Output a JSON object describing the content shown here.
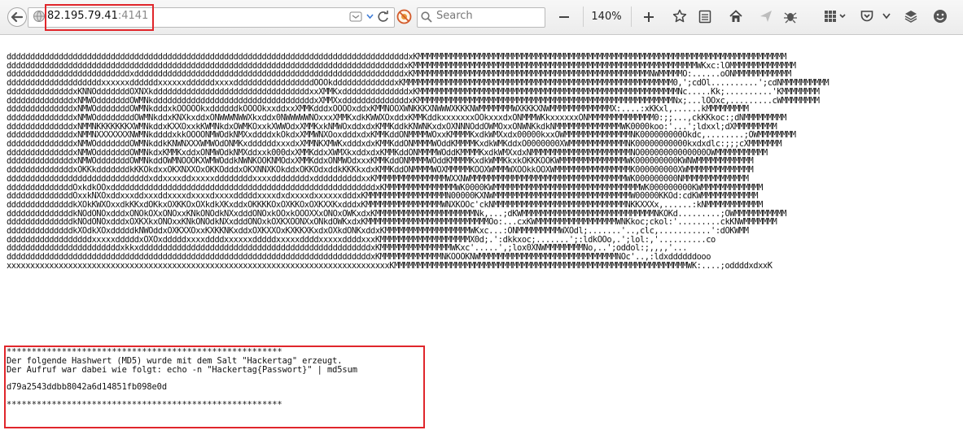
{
  "browser": {
    "url_host": "82.195.79.41",
    "url_port": ":4141",
    "search_placeholder": "Search",
    "zoom_level": "140%",
    "icons": [
      "back-icon",
      "site-info-icon",
      "reader-mode-icon",
      "dropdown-icon",
      "reload-icon",
      "addon-blocked-icon",
      "search-icon",
      "zoom-out-icon",
      "zoom-in-icon",
      "bookmark-star-icon",
      "reading-list-icon",
      "home-icon",
      "send-icon",
      "bug-icon",
      "grid-icon",
      "pocket-icon",
      "layers-icon",
      "smiley-icon"
    ],
    "highlight_color": "#e0262b"
  },
  "page": {
    "ascii_art": "dddddddddddddddddddddddddddddddddddddddddddddddddddddddddddddddddddddddddddddddddddddxKMMMMMMMMMMMMMMMMMMMMMMMMMMMMMMMMMMMMMMMMMMMMMMMMMMMMMMMMMMMMMMMMMMMMMMMMMMMMMM\nddddddddddddddddddddddddddddddddddddddddddddddddddddddddddddddddddddddddddddddddddddxKMMMMMMMMMMMMMMMMMMMMMMMMMMMMMMMMMMMMMMMMMMMMMMMMMMMMMMMMMMMMWKxc:lOMMMMMMMMMMMMMM\nddddddddddddddddddddddddddxdddddddddddddddddddddddddddddddddddddddddddddddddddddddddxKMMMMMMMMMMMMMMMMMMMMMMMMMMMMMMMMMMMMMMMMMMMMMMMMMMNWMMMMMO:......oONMMMMMMMMMMMM\nddddddddddddddddddddxxxxxxddddddxxxxxxddddddxxxxdddddddddddddddddOOOkdddddddddddddxKMMMMMMMMMMMMMMMMMMMMMMMMMMMMMMMMMMMMMMMMMMMMMMMMMMMMMMMMM0,';cdOl..........';cdNMMMMMMMMMM\nddddddddddddddxKNNOdddddddOXNXkdddddddddddddddddddddddddddddddddxxXMMKxddddddddddddddxKMMMMMMMMMMMMMMMMMMMMMMMMMMMMMMMMMMMMMMMMMMMMMMMMMMMMMMMNc.....Kk;..........'KMMMMMMMM\nddddddddddddddxNMWOdddddddOWMNkddddddddddddddddddddddddddddddddddxXMMXxddddddddddddddxKMMMMMMMMMMMMMMMMMMMMMMMMMMMMMMMMMMMMMMMMMMMMMMMMMMMMMMNx;...lOOxc,.........cWMMMMMMMM\nddddddddddddddxNMWOdddddddOWMNkdddxkOOOOOkxddddddkOOOOkxxddxxXMMKdddxOOOOxddxKMMNOOXWNKKKXNWWWXKKKNWMMMMMMMWXKKKXNWMMMMMMMMMMMMMX:....:xKKxl,......kMMMMMMMMM\nddddddddddddddxNMWOddddddddOWMNkddxKNXkxddxONWWWNWWXkxddx0NWWWWWNOxxxXMMKxdkKWWXOxddxKMMKddkxxxxxxxOOkxxxdxONMMMWKkxxxxxxONMMMMMMMMMMMMMM0:;;...,ckKKkoc:;dNMMMMMMMMM\nddddddddddddddxNMMNKKKKKKKXWMNkddxKXXOxxkKWMNkdxOWMKOxxkXWWOdxXMMKxkNMWOxddxdxKMMKddkKNWNKxdxOXNNNOddOWMOxxONWNKkdkNMMMMMMMMMMMMMMWK0000koo:'...';ldxxl;dXMMMMMMMMM\nddddddddddddddxNMMNXXXXXXXNWMNkddddxkkOOOONMWOdkNMXxddddxkOkdxXMMWNXOoxdddxdxKMMKddONMMMMWOxxKMMMMKxdkWMXxdx00000kxxOWMMMMMMMMMMMMMMNK000000000Okdc,........;OWMMMMMMMM\nddddddddddddddxNMWOdddddddOWMNkddkKNWNXXXWMWOdONMKxddddddxxxdxXMMNKXMWKxdddxdxKMMKddONMMMMWOddKMMMMKxdkWMKddxO0000000XWMMMMMMMMMMMMNK00000000000kxdxdlc:;;;cXMMMMMMM\nddddddddddddddxNMWOdddddddOWMNkdxKMMKxddxONMWOdkNMXddxxk000dxXMMKddxXWMXkxddxdxKMMKddONMMMMWOddKMMMMKxdkWMXxdxNMMMMMMMMMMMMMMMMMMMMMNO00000000000000OWMMMMMMMMMMM\nddddddddddddddxNMWOdddddddOWMNkddOWMNOOOKXWMWOddkNWNKOOKNMOdxXMMKddxONMWOdxxxKMMKddONMMMMWOddKMMMMKxdkWMMKkxkOKKKOOKWMMMMMMMMMMMMMMWK000000000KWNWMMMMMMMMMMMM\nddddddddddddddxOKKkdddddddkKKOkdxxOKXNXXOxOKKOdddxOKXNNXKOkddxOKKOdxddkKKKkxdxKMMKddONMMMMWOXMMMMMKOOXWMMMWXOOkkOOXWMMMMMMMMMMMMMMMMK000000000XWMMMMMMMMMMMMMM\nddddddddddddddddddddddddddddddxddxxxxddxxxxxddddddddxxxxddddddddxddddddddddxxKMMMMMMMMMMMMMMMWXXNWMMMMMMMMMMMMMMMMMMMMMMMMMMMMMMMMMWK000000000NMMMMMMMMMMMMMM\nddddddddddddddOxkdkOOxddddddddddddddddddddddddddddddddddddddddddddddddddddddddxKMMMMMMMMMMMMMMMWK0000KWMMMMMMMMMMMMMMMMMMMMMMMMMMMMMMMWK000000000KWMMMMMMMMMMMMM\nddddddddddddddOxxkNXOxddxxxddxxxddxxxxdxxxxdxxxxdddddxxxxdxdxxxxdxxxxxxdddxKMMMMMMMMMMMMMMMMMN00000KXNWMMMMMMMMMMMMMMMMMMMMMMMMMMMMMW00000KKOd:cdKWMMMMMMMMMMMM\nddddddddddddddkXOkKWXOxxdkKKxdOKkxOXKKOxOXkdkXKxddxOKKKKOxOXKKOxOXKXXKxdddxKMMMMMMMMMMMMMMMMWNXKOOc'ckNMMMMMMMMMMMMMMMMMMMMMMMMMMMMNKKXXXx,......:kNMMMMMMMMMMMM\nddddddddddddddkNOdONOxdddxONOkOXxONOxxKNkONOdkNXxdddONOxkOOxkOOOXXxONOxOWKxdxKMMMMMMMMMMMMMMMMMMMMMNk,...;dKWMMMMMMMMMMMMMMMMMMMMMMMMMMMMNKOKd.........;OWMMMMMMMMMMM\nddddddddddddddkNOdONOxdddxOXKXkxONOxxKNkONOdkNXxdddONOxkOXKXOONXxONkdOWKxdxKMMMMMMMMMMMMMMMMMMMMMMMMMMOo:...cxKWMMMMMMMMMMMMMMMMMWNKkoc;ckol:'.........ckKNWMMMMMMM\nddddddddddddddkXOdkXOxdddddkNWOddxOXKXXOxxKXKKNKxddxOXKXXOxKXKKXKxdxOXkdONKxddxKMMMMMMMMMMMMMMMMMMWKxc...:ONMMMMMMMMMWXOdl;.......'..,clc,...........':dOKWMM\nddddddddddddddddddxxxxxdddddxOXOxdddddxxxxddddxxxxxxdddddxxxxxddddxxxxxddddxxxKMMMMMMMMMMMMMMMMMMMX0d;.':dkkxoc;.......';:ldkOOo,.';lol:,'..........co\nddddddddddddddddddddddddxkkxdddddddddddddddddddddddddddddddddddddddddddddddddxKMMMMMMMMMMMMMMMWKxc'.....',;lox0XNWMMMMMMMMNo,..';oddol:;,,,,'...\ndddddddddddddddddddddddddddddddddddddddddddddddddddddddddddddddddddddddddddddxKMMMMMMMMMMMMMNKOOOKNWMMMMMMMMMMMMMMMMMMMMMMMMMMMMMNOc'..,:ldxddddddooo\nxxxxxxxxxxxxxxxxxxxxxxxxxxxxxxxxxxxxxxxxxxxxxxxxxxxxxxxxxxxxxxxxxxxxxxxxxxxxxxxxxKMMMMMMMMMMMMMMMMMMMMMMMMMMMMMMMMMMMMMMMMMMMMMMMMMMMMMMMMMMMMMMWK:....;oddddxdxxK",
    "message": "*******************************************************\nDer folgende Hashwert (MD5) wurde mit dem Salt \"Hackertag\" erzeugt.\nDer Aufruf war dabei wie folgt: echo -n \"Hackertag{Passwort}\" | md5sum\n\nd79a2543ddbb8042a6d14851fb098e0d\n\n*******************************************************"
  }
}
